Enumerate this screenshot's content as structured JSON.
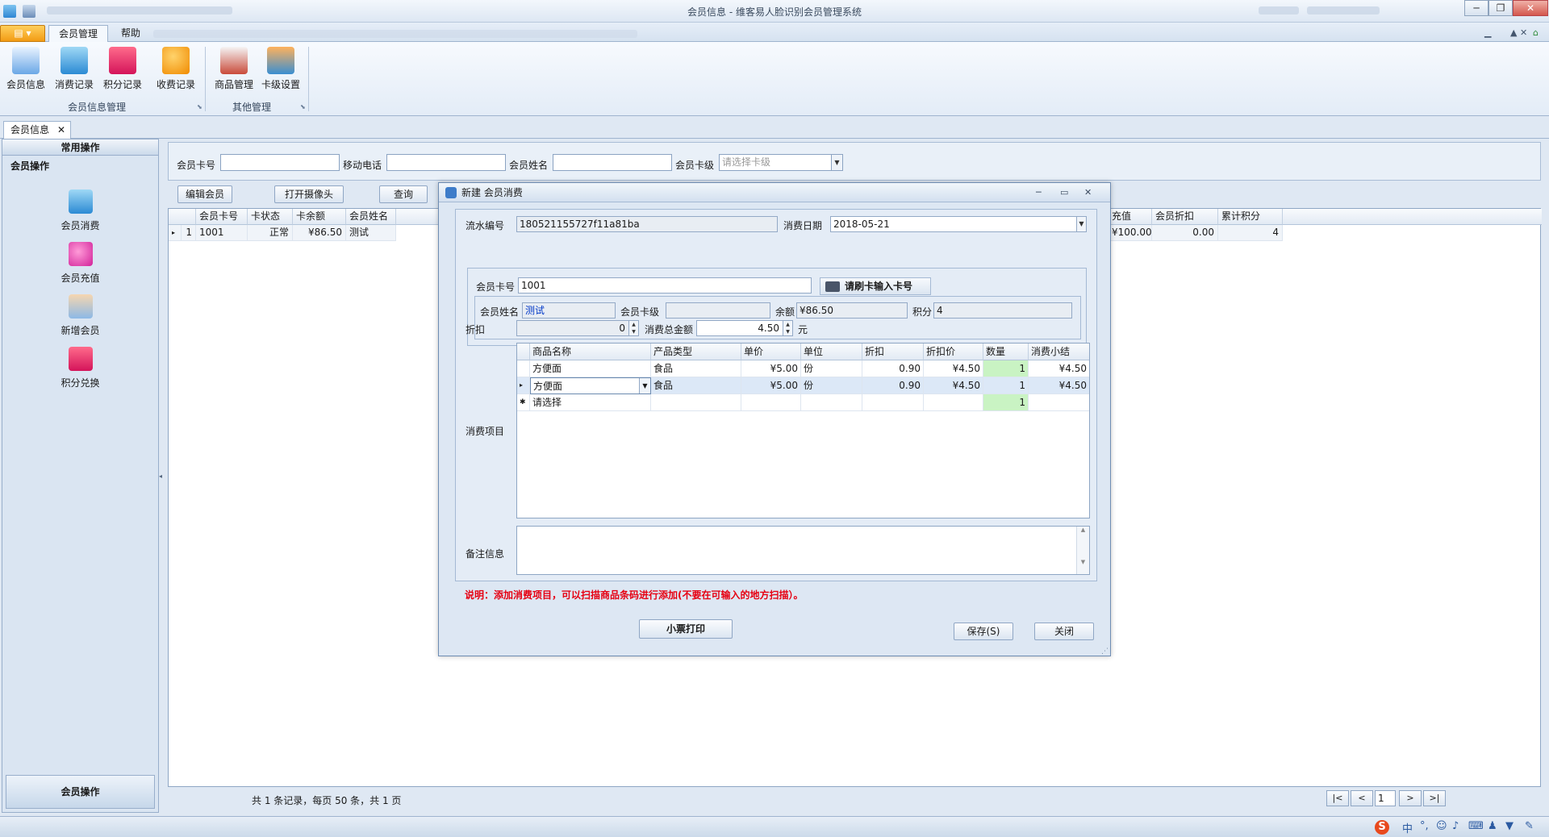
{
  "window": {
    "title": "会员信息 - 维客易人脸识别会员管理系统"
  },
  "ribbon": {
    "tabs": [
      "会员管理",
      "帮助"
    ],
    "active_tab": "会员管理",
    "groups": [
      {
        "label": "会员信息管理",
        "buttons": [
          "会员信息",
          "消费记录",
          "积分记录",
          "收费记录"
        ]
      },
      {
        "label": "其他管理",
        "buttons": [
          "商品管理",
          "卡级设置"
        ]
      }
    ]
  },
  "doc_tab": {
    "label": "会员信息",
    "close": "✕"
  },
  "leftnav": {
    "header": "常用操作",
    "group": "会员操作",
    "items": [
      "会员消费",
      "会员充值",
      "新增会员",
      "积分兑换"
    ],
    "footer": "会员操作"
  },
  "search": {
    "card_label": "会员卡号",
    "mobile_label": "移动电话",
    "name_label": "会员姓名",
    "level_label": "会员卡级",
    "level_placeholder": "请选择卡级"
  },
  "toolbar": {
    "edit": "编辑会员",
    "camera": "打开摄像头",
    "query": "查询"
  },
  "member_grid": {
    "columns": [
      "会员卡号",
      "卡状态",
      "卡余额",
      "会员姓名"
    ],
    "columns_right": [
      "充值",
      "会员折扣",
      "累计积分"
    ],
    "rows": [
      {
        "no": "1",
        "card": "1001",
        "status": "正常",
        "balance": "¥86.50",
        "name": "测试",
        "recharge": "¥100.00",
        "discount": "0.00",
        "points": "4"
      }
    ]
  },
  "pager": {
    "summary": "共 1 条记录，每页 50 条，共 1 页",
    "first": "|<",
    "prev": "<",
    "page": "1",
    "next": ">",
    "last": ">|"
  },
  "dialog": {
    "title": "新建 会员消费",
    "serial_label": "流水编号",
    "serial_value": "180521155727f11a81ba",
    "date_label": "消费日期",
    "date_value": "2018-05-21",
    "card_label": "会员卡号",
    "card_value": "1001",
    "swipe_button": "请刷卡输入卡号",
    "name_label": "会员姓名",
    "name_value": "测试",
    "level_label": "会员卡级",
    "level_value": "",
    "balance_label": "余额",
    "balance_value": "¥86.50",
    "points_label": "积分",
    "points_value": "4",
    "discount_label": "折扣",
    "discount_value": "0",
    "total_label": "消费总金额",
    "total_value": "4.50",
    "total_unit": "元",
    "items_label": "消费项目",
    "items_columns": [
      "商品名称",
      "产品类型",
      "单价",
      "单位",
      "折扣",
      "折扣价",
      "数量",
      "消费小结"
    ],
    "items_rows": [
      {
        "name": "方便面",
        "type": "食品",
        "price": "¥5.00",
        "unit": "份",
        "discount": "0.90",
        "disc_price": "¥4.50",
        "qty": "1",
        "subtotal": "¥4.50"
      },
      {
        "name": "方便面",
        "type": "食品",
        "price": "¥5.00",
        "unit": "份",
        "discount": "0.90",
        "disc_price": "¥4.50",
        "qty": "1",
        "subtotal": "¥4.50"
      },
      {
        "name": "请选择",
        "qty": "1"
      }
    ],
    "notes_label": "备注信息",
    "hint": "说明：添加消费项目，可以扫描商品条码进行添加(不要在可输入的地方扫描）。",
    "print_button": "小票打印",
    "save_button": "保存(S)",
    "close_button": "关闭"
  }
}
